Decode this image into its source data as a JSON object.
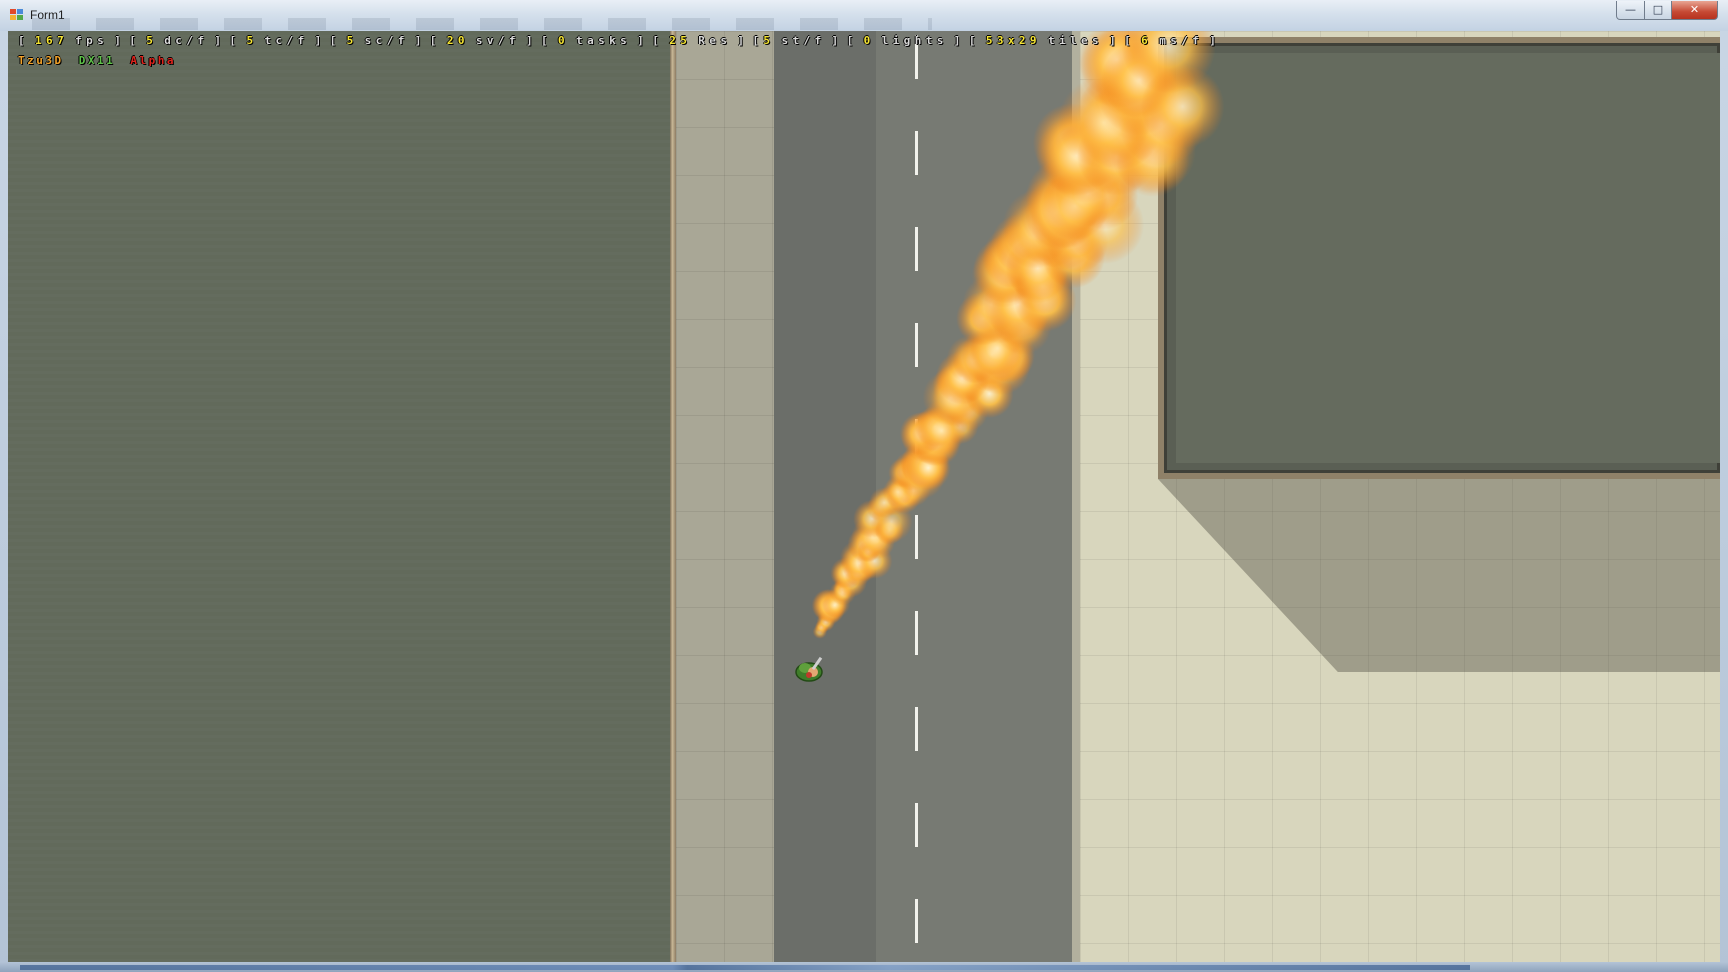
{
  "window": {
    "title": "Form1",
    "minimize_glyph": "—",
    "maximize_glyph": "□",
    "close_glyph": "✕"
  },
  "hud": {
    "open": "[",
    "close": "]",
    "close_open": "] [",
    "stats": [
      {
        "value": "167",
        "unit": "fps"
      },
      {
        "value": "5",
        "unit": "dc/f"
      },
      {
        "value": "5",
        "unit": "tc/f"
      },
      {
        "value": "5",
        "unit": "sc/f"
      },
      {
        "value": "20",
        "unit": "sv/f"
      },
      {
        "value": "0",
        "unit": "tasks"
      },
      {
        "value": "25",
        "unit": "Res"
      },
      {
        "value": "5",
        "unit": "st/f",
        "compact": true
      },
      {
        "value": "0",
        "unit": "lights"
      },
      {
        "value": "53x29",
        "unit": "tiles"
      },
      {
        "value": "6",
        "unit": "ms/f"
      }
    ],
    "engine": "Tzu3D",
    "api": "DX11",
    "stage": "Alpha"
  },
  "colors": {
    "hud_value": "#f5e432",
    "engine": "#f3a32a",
    "api": "#5fc24a",
    "stage": "#e0231c"
  },
  "scene": {
    "player": "soldier-with-flamethrower",
    "effect": "flame-stream"
  }
}
